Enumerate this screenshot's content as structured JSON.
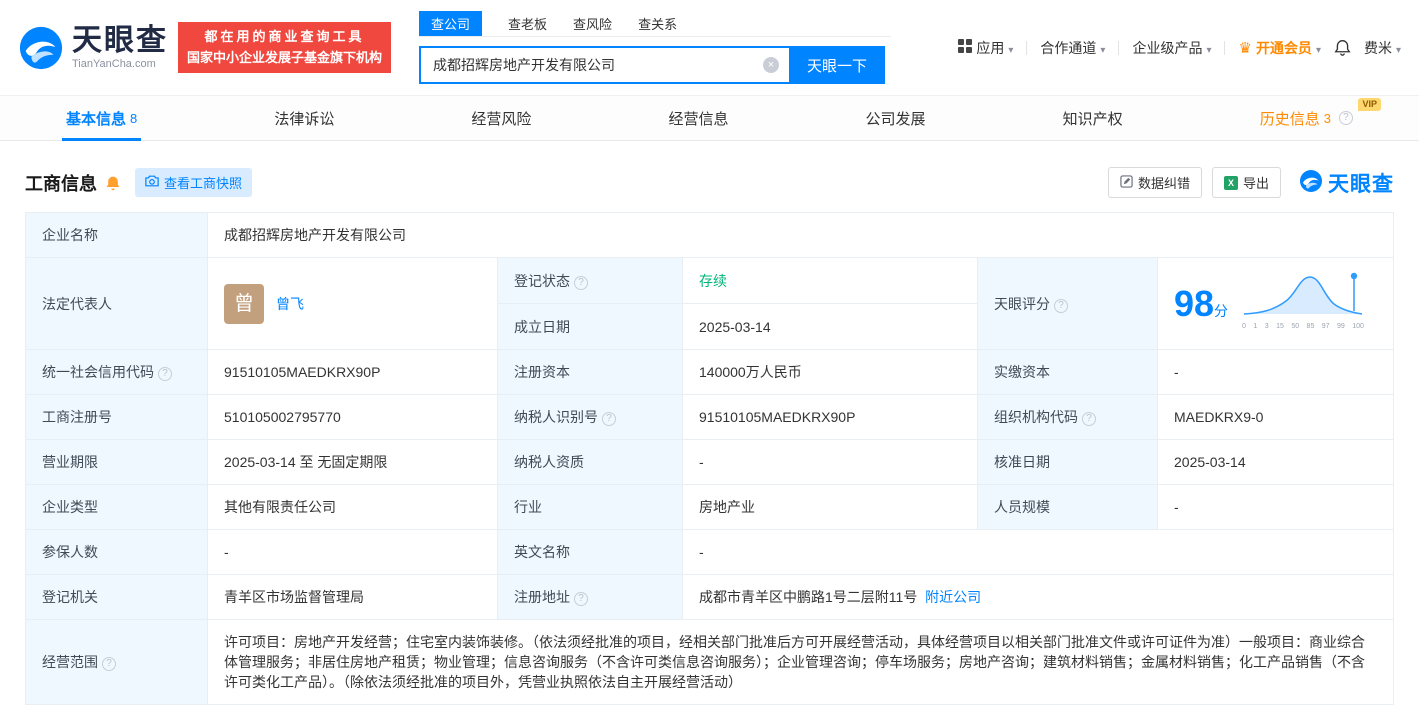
{
  "colors": {
    "primary": "#0084ff",
    "red": "#f0483f",
    "orange": "#ff8a00",
    "green": "#00b578",
    "vip_gold": "#ffd76f"
  },
  "header": {
    "logo": {
      "brand": "天眼查",
      "domain": "TianYanCha.com"
    },
    "slogan": {
      "line1": "都在用的商业查询工具",
      "line2": "国家中小企业发展子基金旗下机构"
    },
    "search_tabs": [
      {
        "label": "查公司",
        "active": true
      },
      {
        "label": "查老板",
        "active": false
      },
      {
        "label": "查风险",
        "active": false
      },
      {
        "label": "查关系",
        "active": false
      }
    ],
    "search": {
      "value": "成都招辉房地产开发有限公司",
      "button": "天眼一下"
    },
    "nav": {
      "apps": "应用",
      "partner": "合作通道",
      "enterprise": "企业级产品",
      "vip": "开通会员",
      "user": "费米"
    }
  },
  "tabs": [
    {
      "label": "基本信息",
      "badge": "8"
    },
    {
      "label": "法律诉讼",
      "badge": ""
    },
    {
      "label": "经营风险",
      "badge": ""
    },
    {
      "label": "经营信息",
      "badge": ""
    },
    {
      "label": "公司发展",
      "badge": ""
    },
    {
      "label": "知识产权",
      "badge": ""
    },
    {
      "label": "历史信息",
      "badge": "3",
      "vip_tag": "VIP"
    }
  ],
  "section": {
    "title": "工商信息",
    "snapshot_button": "查看工商快照",
    "correction_button": "数据纠错",
    "export_button": "导出",
    "brand": "天眼查"
  },
  "table": {
    "company_name": {
      "label": "企业名称",
      "value": "成都招辉房地产开发有限公司"
    },
    "legal_rep": {
      "label": "法定代表人",
      "avatar": "曾",
      "name": "曾飞"
    },
    "reg_status": {
      "label": "登记状态",
      "value": "存续"
    },
    "score": {
      "label": "天眼评分",
      "value": "98",
      "unit": "分",
      "axis": [
        "0",
        "1",
        "3",
        "15",
        "50",
        "85",
        "97",
        "99",
        "100"
      ]
    },
    "establish_date": {
      "label": "成立日期",
      "value": "2025-03-14"
    },
    "credit_code": {
      "label": "统一社会信用代码",
      "value": "91510105MAEDKRX90P"
    },
    "reg_capital": {
      "label": "注册资本",
      "value": "140000万人民币"
    },
    "paid_capital": {
      "label": "实缴资本",
      "value": "-"
    },
    "reg_number": {
      "label": "工商注册号",
      "value": "510105002795770"
    },
    "taxpayer_id": {
      "label": "纳税人识别号",
      "value": "91510105MAEDKRX90P"
    },
    "org_code": {
      "label": "组织机构代码",
      "value": "MAEDKRX9-0"
    },
    "business_term": {
      "label": "营业期限",
      "value": "2025-03-14 至 无固定期限"
    },
    "taxpayer_quality": {
      "label": "纳税人资质",
      "value": "-"
    },
    "approval_date": {
      "label": "核准日期",
      "value": "2025-03-14"
    },
    "company_type": {
      "label": "企业类型",
      "value": "其他有限责任公司"
    },
    "industry": {
      "label": "行业",
      "value": "房地产业"
    },
    "staff_size": {
      "label": "人员规模",
      "value": "-"
    },
    "insured_count": {
      "label": "参保人数",
      "value": "-"
    },
    "english_name": {
      "label": "英文名称",
      "value": "-"
    },
    "reg_authority": {
      "label": "登记机关",
      "value": "青羊区市场监督管理局"
    },
    "reg_address": {
      "label": "注册地址",
      "value": "成都市青羊区中鹏路1号二层附11号",
      "link": "附近公司"
    },
    "business_scope": {
      "label": "经营范围",
      "value": "许可项目：房地产开发经营；住宅室内装饰装修。（依法须经批准的项目，经相关部门批准后方可开展经营活动，具体经营项目以相关部门批准文件或许可证件为准）一般项目：商业综合体管理服务；非居住房地产租赁；物业管理；信息咨询服务（不含许可类信息咨询服务）；企业管理咨询；停车场服务；房地产咨询；建筑材料销售；金属材料销售；化工产品销售（不含许可类化工产品）。（除依法须经批准的项目外，凭营业执照依法自主开展经营活动）"
    }
  }
}
